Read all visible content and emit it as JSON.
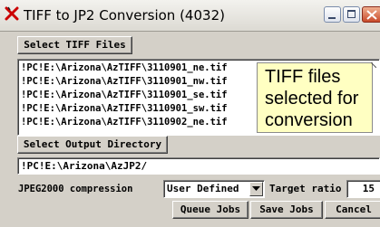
{
  "window": {
    "title": "TIFF to JP2 Conversion (4032)"
  },
  "tiff": {
    "select_label": "Select TIFF Files",
    "files": [
      "!PC!E:\\Arizona\\AzTIFF\\3110901_ne.tif",
      "!PC!E:\\Arizona\\AzTIFF\\3110901_nw.tif",
      "!PC!E:\\Arizona\\AzTIFF\\3110901_se.tif",
      "!PC!E:\\Arizona\\AzTIFF\\3110901_sw.tif",
      "!PC!E:\\Arizona\\AzTIFF\\3110902_ne.tif"
    ]
  },
  "callout": {
    "lines": [
      "TIFF files",
      "selected for",
      "conversion"
    ],
    "background": "#ffffc2"
  },
  "output": {
    "select_label": "Select Output Directory",
    "directory": "!PC!E:\\Arizona\\AzJP2/"
  },
  "compression": {
    "label": "JPEG2000 compression",
    "selected": "User Defined",
    "target_ratio_label": "Target ratio",
    "target_ratio_value": "15"
  },
  "actions": {
    "queue_label": "Queue Jobs",
    "save_label": "Save Jobs",
    "cancel_label": "Cancel"
  },
  "icons": {
    "app": "red-x-app-icon",
    "minimize": "minimize-icon",
    "maximize": "maximize-icon",
    "close": "close-icon",
    "dropdown": "dropdown-arrow-icon"
  },
  "colors": {
    "dialog_bg": "#d4d0c8",
    "close_button": "#c84a2a",
    "app_icon": "#cc0000"
  }
}
